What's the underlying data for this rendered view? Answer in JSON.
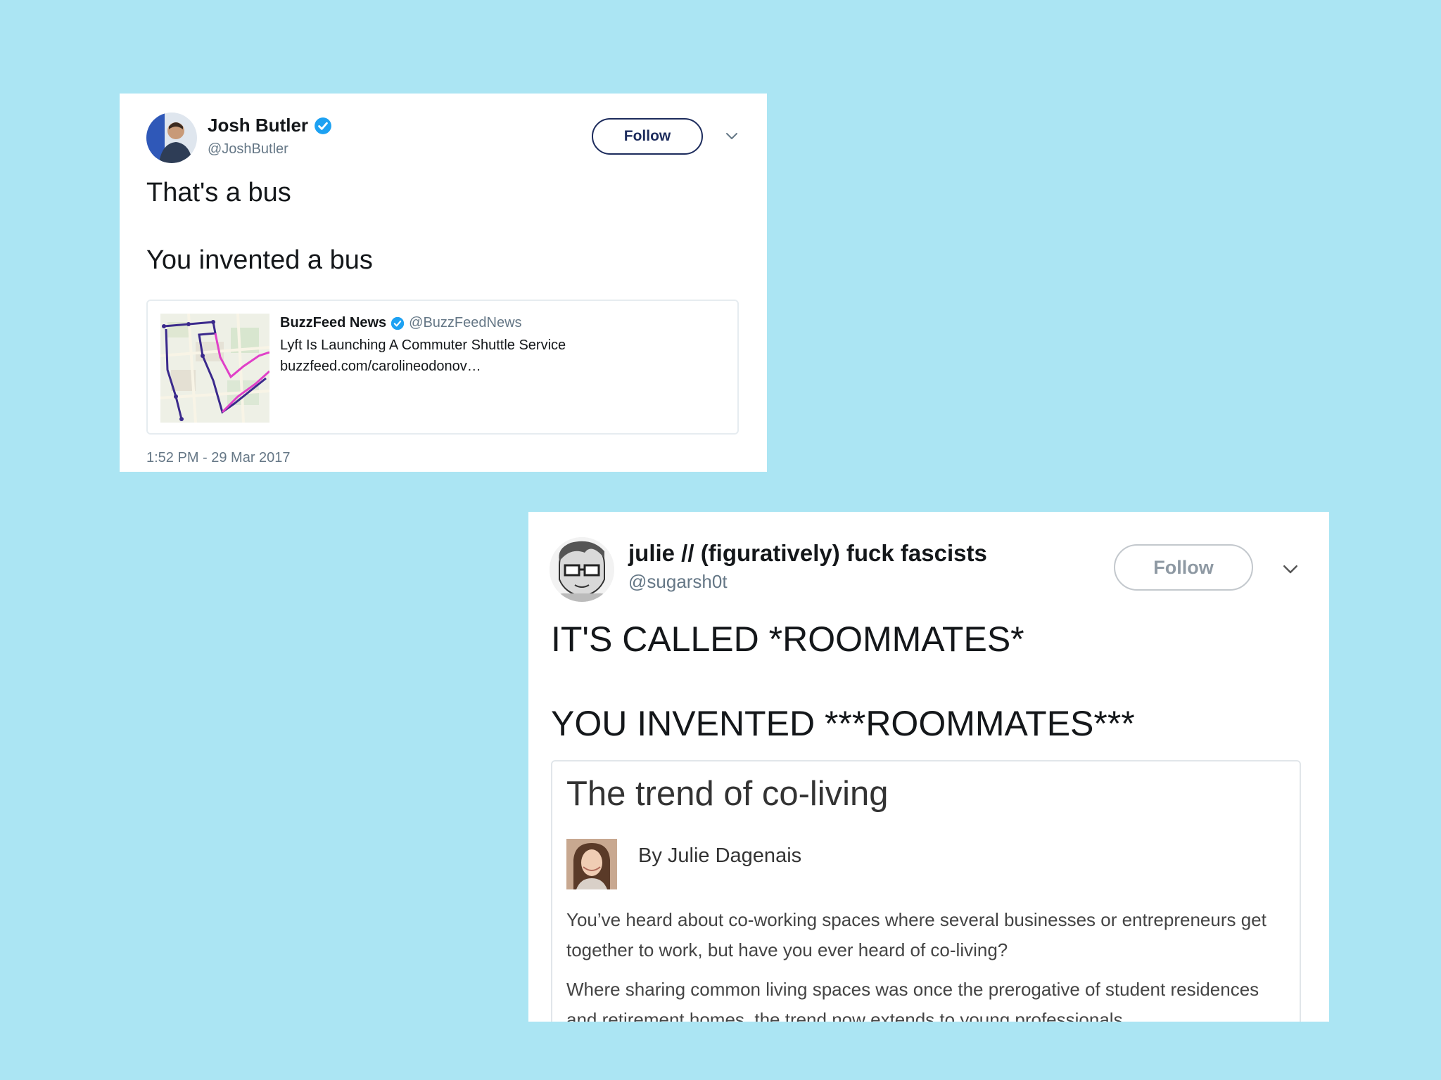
{
  "tweets": [
    {
      "author": {
        "name": "Josh Butler",
        "handle": "@JoshButler",
        "verified": true,
        "avatar_icon": "user-photo-avatar"
      },
      "follow_label": "Follow",
      "menu_icon": "chevron-down-icon",
      "text_line1": "That's a bus",
      "text_line2": "You invented a bus",
      "quoted": {
        "name": "BuzzFeed News",
        "handle": "@BuzzFeedNews",
        "verified": true,
        "title": "Lyft Is Launching A Commuter Shuttle Service",
        "url": "buzzfeed.com/carolineodonov…",
        "thumbnail_icon": "route-map-thumbnail"
      },
      "timestamp": "1:52 PM - 29 Mar 2017"
    },
    {
      "author": {
        "name": "julie // (figuratively) fuck fascists",
        "handle": "@sugarsh0t",
        "avatar_icon": "cartoon-avatar"
      },
      "follow_label": "Follow",
      "menu_icon": "chevron-down-icon",
      "text_line1": "IT'S CALLED *ROOMMATES*",
      "text_line2": "YOU INVENTED ***ROOMMATES***",
      "article": {
        "title": "The trend of co-living",
        "byline_prefix": "By",
        "byline_author": "Julie Dagenais",
        "paragraph1": "You’ve heard about co-working spaces where several businesses or entrepreneurs get together to work, but have you ever heard of co-living?",
        "paragraph2": "Where sharing common living spaces was once the prerogative of student residences and retirement homes, the trend now extends to young professionals."
      }
    }
  ],
  "colors": {
    "background": "#abe5f3",
    "verified_blue": "#1da1f2",
    "follow_dark": "#1c2b5c",
    "follow_muted": "#8e99a3",
    "route_purple": "#3b2a8c",
    "route_magenta": "#e040c8"
  }
}
